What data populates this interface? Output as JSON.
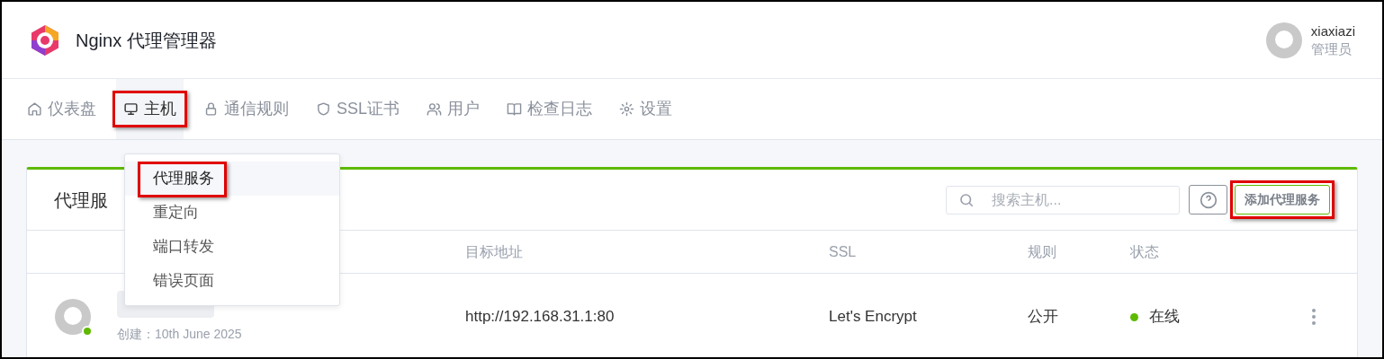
{
  "app": {
    "title": "Nginx 代理管理器"
  },
  "user": {
    "name": "xiaxiazi",
    "role": "管理员"
  },
  "nav": [
    {
      "label": "仪表盘",
      "kind": "home",
      "selected": false,
      "highlighted": false
    },
    {
      "label": "主机",
      "kind": "monitor",
      "selected": true,
      "highlighted": true
    },
    {
      "label": "通信规则",
      "kind": "lock",
      "selected": false,
      "highlighted": false
    },
    {
      "label": "SSL证书",
      "kind": "shield",
      "selected": false,
      "highlighted": false
    },
    {
      "label": "用户",
      "kind": "users",
      "selected": false,
      "highlighted": false
    },
    {
      "label": "检查日志",
      "kind": "book",
      "selected": false,
      "highlighted": false
    },
    {
      "label": "设置",
      "kind": "gear",
      "selected": false,
      "highlighted": false
    }
  ],
  "dropdown": [
    {
      "label": "代理服务",
      "selected": true,
      "highlighted": true
    },
    {
      "label": "重定向",
      "selected": false,
      "highlighted": false
    },
    {
      "label": "端口转发",
      "selected": false,
      "highlighted": false
    },
    {
      "label": "错误页面",
      "selected": false,
      "highlighted": false
    }
  ],
  "card": {
    "title": "代理服",
    "search": {
      "placeholder": "搜索主机..."
    },
    "add_button": {
      "label": "添加代理服务",
      "highlighted": true
    }
  },
  "table": {
    "columns": [
      "目标地址",
      "SSL",
      "规则",
      "状态"
    ],
    "rows": [
      {
        "created": "创建：10th June 2025",
        "destination": "http://192.168.31.1:80",
        "ssl": "Let's Encrypt",
        "rule": "公开",
        "status": "在线",
        "online": true
      }
    ]
  }
}
